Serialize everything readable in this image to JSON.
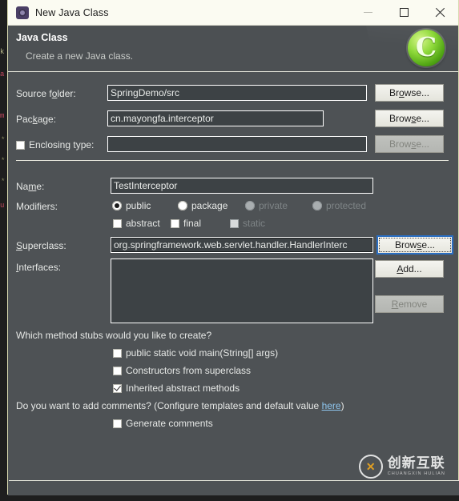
{
  "window": {
    "title": "New Java Class",
    "icon": "java-class-icon",
    "controls": {
      "minimize": "minimize-button",
      "maximize": "maximize-button",
      "close": "close-button"
    }
  },
  "header": {
    "title": "Java Class",
    "subtitle": "Create a new Java class.",
    "logo_letter": "C"
  },
  "form": {
    "source_folder": {
      "label": "Source folder:",
      "value": "SpringDemo/src",
      "button": "Browse..."
    },
    "package": {
      "label": "Package:",
      "value": "cn.mayongfa.interceptor",
      "button": "Browse..."
    },
    "enclosing_type": {
      "label": "Enclosing type:",
      "checked": false,
      "value": "",
      "button": "Browse..."
    },
    "name": {
      "label": "Name:",
      "value": "TestInterceptor"
    },
    "modifiers": {
      "label": "Modifiers:",
      "access": [
        {
          "label": "public",
          "selected": true,
          "enabled": true
        },
        {
          "label": "package",
          "selected": false,
          "enabled": true
        },
        {
          "label": "private",
          "selected": false,
          "enabled": false
        },
        {
          "label": "protected",
          "selected": false,
          "enabled": false
        }
      ],
      "flags": [
        {
          "label": "abstract",
          "checked": false,
          "enabled": true
        },
        {
          "label": "final",
          "checked": false,
          "enabled": true
        },
        {
          "label": "static",
          "checked": false,
          "enabled": false
        }
      ]
    },
    "superclass": {
      "label": "Superclass:",
      "value": "org.springframework.web.servlet.handler.HandlerInterc",
      "button": "Browse..."
    },
    "interfaces": {
      "label": "Interfaces:",
      "items": [],
      "add_button": "Add...",
      "remove_button": "Remove"
    }
  },
  "stubs": {
    "question": "Which method stubs would you like to create?",
    "options": [
      {
        "label": "public static void main(String[] args)",
        "checked": false
      },
      {
        "label": "Constructors from superclass",
        "checked": false
      },
      {
        "label": "Inherited abstract methods",
        "checked": true
      }
    ]
  },
  "comments": {
    "prefix": "Do you want to add comments? (Configure templates and default value ",
    "link": "here",
    "suffix": ")",
    "option": {
      "label": "Generate comments",
      "checked": false
    }
  },
  "watermark": {
    "cn": "创新互联",
    "en": "CHUANGXIN HULIAN"
  },
  "colors": {
    "dialog_bg": "#4e5255",
    "field_bg": "#3d4245",
    "titlebar_bg": "#fbfbf2",
    "accent_focus": "#2a6fc4",
    "link": "#8ec6ef",
    "border": "#e9e9de"
  }
}
